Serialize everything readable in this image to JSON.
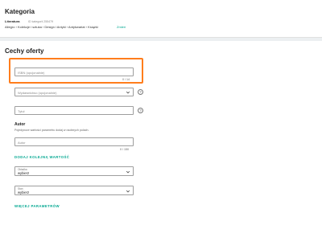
{
  "category": {
    "title": "Kategoria",
    "name": "Literatura",
    "id_text": "ID kategorii 255479",
    "path": "Allegro › Kolekcje i sztuka › Design i Antyki › Antykwariat › Książki",
    "change_label": "Zmień"
  },
  "features": {
    "title": "Cechy oferty",
    "isbn": {
      "placeholder": "ISBN (opcjonalnie)",
      "counter": "0 / 14"
    },
    "publisher": {
      "placeholder": "Wydawnictwo (opcjonalnie)"
    },
    "title_field": {
      "placeholder": "Tytuł"
    },
    "author": {
      "heading": "Autor",
      "description": "Pojedyncze wartości parametru dodaj w osobnych polach.",
      "placeholder": "Autor",
      "counter": "0 / 150",
      "add_value_label": "DODAJ KOLEJNĄ WARTOŚĆ"
    },
    "cover": {
      "label": "Okładka",
      "value": "wybierz"
    },
    "condition": {
      "label": "Stan",
      "value": "wybierz"
    },
    "more_params_label": "WIĘCEJ PARAMETRÓW"
  },
  "colors": {
    "accent": "#00a790",
    "highlight": "#ff7d1c"
  },
  "icons": {
    "help": "help-circle-icon",
    "dropdown": "chevron-down-icon"
  }
}
